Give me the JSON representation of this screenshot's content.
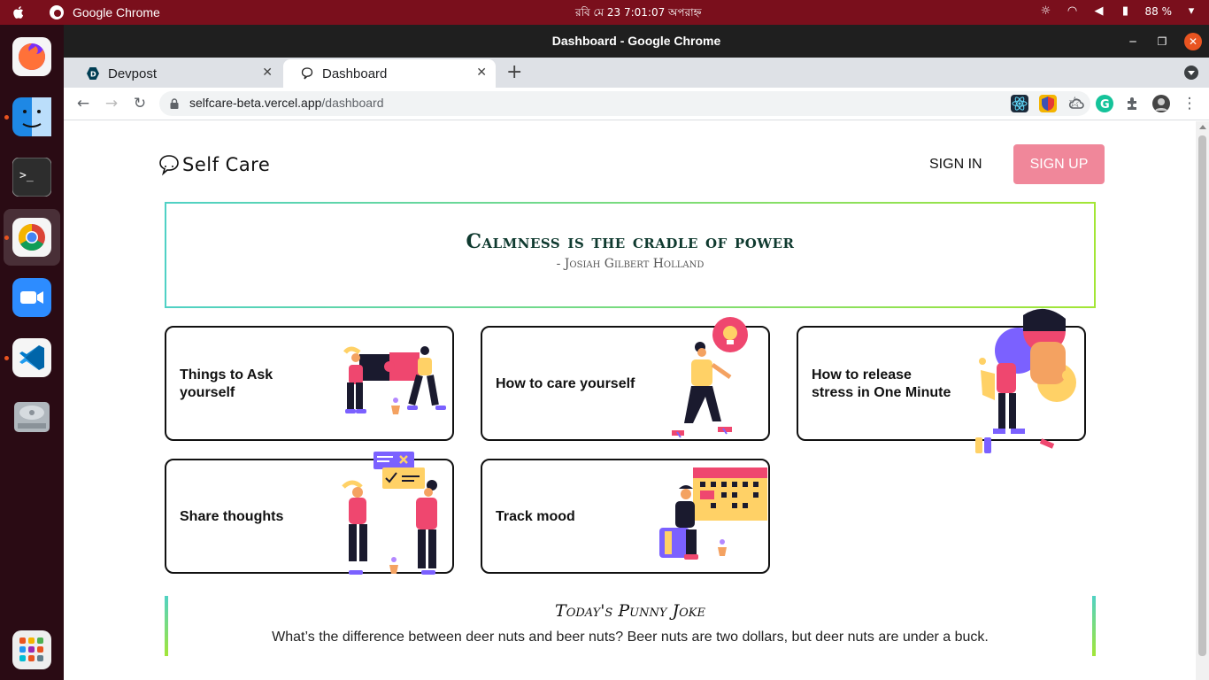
{
  "system_bar": {
    "app_name": "Google Chrome",
    "clock": "রবি মে 23   7:01:07 অপরাহ্ন",
    "battery": "88 %"
  },
  "window": {
    "title": "Dashboard - Google Chrome"
  },
  "tabs": [
    {
      "label": "Devpost",
      "active": false
    },
    {
      "label": "Dashboard",
      "active": true
    }
  ],
  "omnibox": {
    "host": "selfcare-beta.vercel.app",
    "path": "/dashboard"
  },
  "header": {
    "logo_text": "Self Care",
    "signin_label": "SIGN IN",
    "signup_label": "SIGN UP"
  },
  "quote": {
    "text": "Calmness is the cradle of power",
    "author": "- Josiah Gilbert Holland"
  },
  "cards": [
    {
      "line1": "Things to Ask",
      "line2": "yourself"
    },
    {
      "line1": "How to care yourself",
      "line2": ""
    },
    {
      "line1": "How to release",
      "line2": "stress in One Minute"
    },
    {
      "line1": "Share thoughts",
      "line2": ""
    },
    {
      "line1": "Track mood",
      "line2": ""
    }
  ],
  "joke": {
    "title": "Today's Punny Joke",
    "text": "What’s the difference between deer nuts and beer nuts? Beer nuts are two dollars, but deer nuts are under a buck."
  },
  "colors": {
    "accent_pink": "#f0879a",
    "gradient_start": "#4fd1c5",
    "gradient_end": "#a3e635",
    "ubuntu_bar": "#7a0f1c"
  }
}
